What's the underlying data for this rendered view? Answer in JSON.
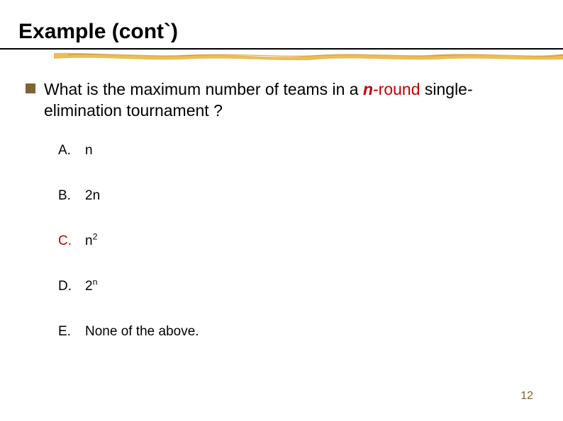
{
  "title": "Example (cont`)",
  "question": {
    "prefix": "What is the maximum number of teams in a ",
    "nvar": "n",
    "middle": "-round",
    "rest": " single-elimination tournament ?"
  },
  "options": {
    "a": {
      "letter": "A.",
      "value": "n"
    },
    "b": {
      "letter": "B.",
      "value_base": "2",
      "value_plain": "n"
    },
    "c": {
      "letter": "C.",
      "value_base": "n",
      "value_sup": "2"
    },
    "d": {
      "letter": "D.",
      "value_base": "2",
      "value_sup": "n"
    },
    "e": {
      "letter": "E.",
      "value": "None of the above."
    }
  },
  "page_number": "12",
  "colors": {
    "accent": "#c00000",
    "bullet": "#7B6436"
  }
}
